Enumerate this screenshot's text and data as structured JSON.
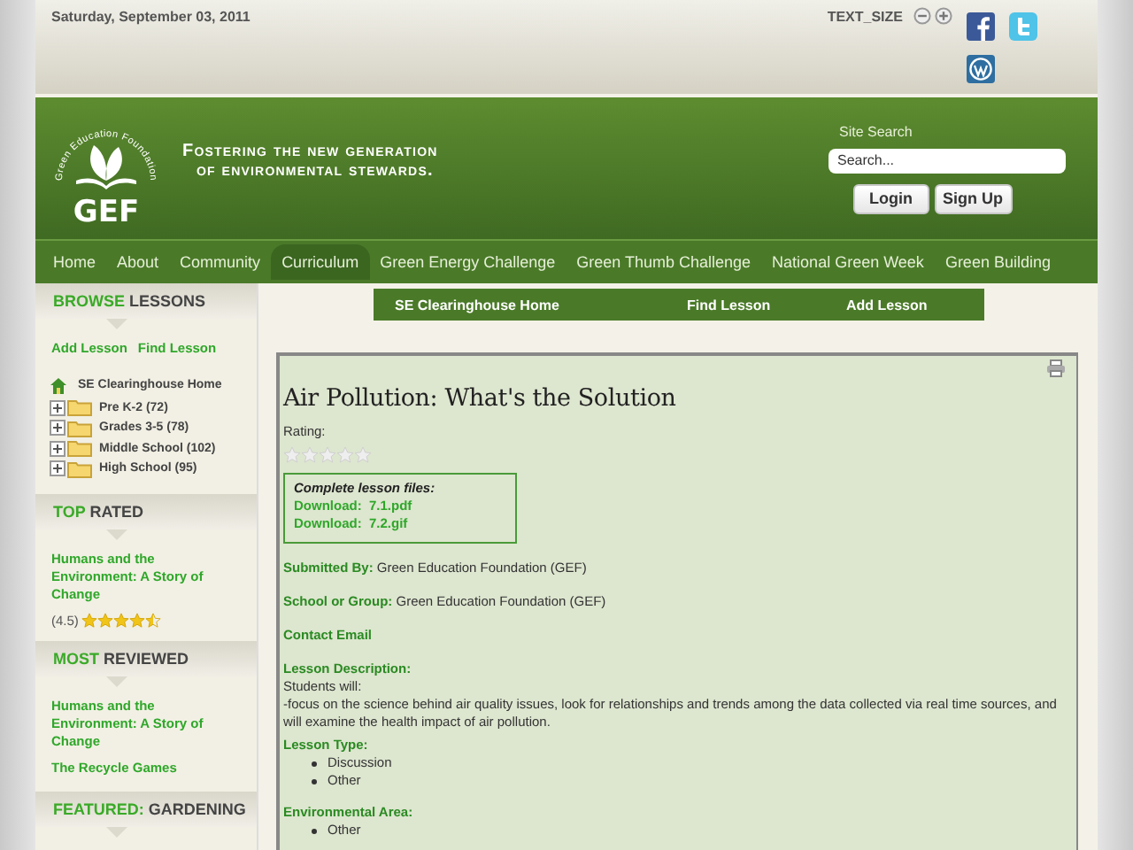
{
  "top_bar": {
    "date": "Saturday, September 03, 2011",
    "text_size_label": "TEXT_SIZE"
  },
  "header": {
    "logo_arc": "Green Education Foundation",
    "logo_text": "GEF",
    "tagline": [
      "Fostering the new generation",
      "of environmental stewards."
    ],
    "search_label": "Site Search",
    "search_placeholder": "Search...",
    "buttons": [
      "Login",
      "Sign Up"
    ]
  },
  "nav": [
    {
      "label": "Home",
      "selected": false
    },
    {
      "label": "About",
      "selected": false
    },
    {
      "label": "Community",
      "selected": false
    },
    {
      "label": "Curriculum",
      "selected": true
    },
    {
      "label": "Green Energy Challenge",
      "selected": false
    },
    {
      "label": "Green Thumb Challenge",
      "selected": false
    },
    {
      "label": "National Green Week",
      "selected": false
    },
    {
      "label": "Green Building",
      "selected": false
    }
  ],
  "sidebar": {
    "browse": {
      "heading_accent": "BROWSE",
      "heading_rest": "LESSONS",
      "links": [
        "Add Lesson",
        "Find Lesson"
      ],
      "tree": {
        "label": "SE Clearinghouse Home",
        "children": [
          {
            "label": "Pre K-2 (72)",
            "expanded": false
          },
          {
            "label": "Grades 3-5 (78)",
            "expanded": false
          },
          {
            "label": "Middle School (102)",
            "expanded": false
          },
          {
            "label": "High School (95)",
            "expanded": false
          }
        ]
      }
    },
    "top_rated": {
      "heading_accent": "TOP",
      "heading_rest": "RATED",
      "items": [
        {
          "title": "Humans and the Environment: A Story of Change",
          "score": "(4.5)",
          "stars": 4.5
        }
      ]
    },
    "most_reviewed": {
      "heading_accent": "MOST",
      "heading_rest": "REVIEWED",
      "items": [
        "Humans and the Environment: A Story of Change",
        "The Recycle Games"
      ]
    },
    "featured": {
      "heading_accent": "FEATURED:",
      "heading_rest": "GARDENING"
    }
  },
  "subnav": [
    "SE Clearinghouse Home",
    "Find Lesson",
    "Add Lesson"
  ],
  "lesson": {
    "title": "Air Pollution: What's the Solution",
    "rating_label": "Rating:",
    "stars": 0,
    "files_title": "Complete lesson files:",
    "downloads": [
      {
        "label": "Download:",
        "file": "7.1.pdf"
      },
      {
        "label": "Download:",
        "file": "7.2.gif"
      }
    ],
    "fields": [
      {
        "kind": "inline",
        "label": "Submitted By:",
        "value": "Green Education Foundation (GEF)"
      },
      {
        "kind": "inline",
        "label": "School or Group:",
        "value": "Green Education Foundation (GEF)"
      },
      {
        "kind": "link",
        "label": "Contact Email"
      },
      {
        "kind": "text",
        "label": "Lesson Description:",
        "lines": [
          "Students will:",
          "-focus on the science behind air quality issues, look for relationships and trends among the data collected via real time sources, and will examine the health impact of air pollution."
        ]
      },
      {
        "kind": "list",
        "label": "Lesson Type:",
        "items": [
          "Discussion",
          "Other"
        ]
      },
      {
        "kind": "list",
        "label": "Environmental Area:",
        "items": [
          "Other"
        ]
      }
    ]
  }
}
